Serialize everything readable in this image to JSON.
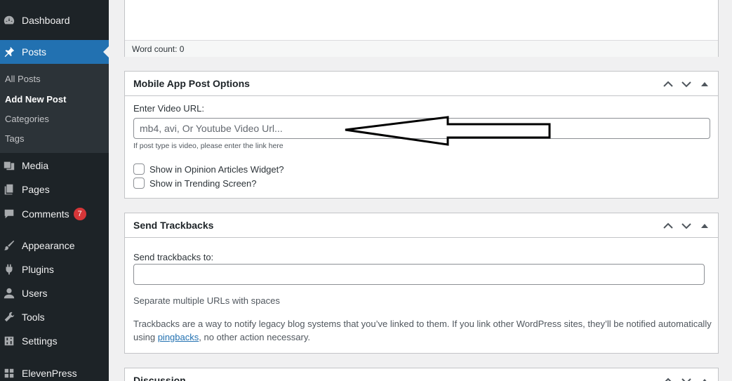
{
  "sidebar": {
    "items": [
      {
        "label": "Dashboard",
        "icon": "dashboard-icon"
      },
      {
        "label": "Posts",
        "icon": "pin-icon",
        "active": true
      },
      {
        "label": "Media",
        "icon": "media-icon"
      },
      {
        "label": "Pages",
        "icon": "pages-icon"
      },
      {
        "label": "Comments",
        "icon": "comment-icon",
        "badge": "7"
      },
      {
        "label": "Appearance",
        "icon": "brush-icon"
      },
      {
        "label": "Plugins",
        "icon": "plugin-icon"
      },
      {
        "label": "Users",
        "icon": "user-icon"
      },
      {
        "label": "Tools",
        "icon": "wrench-icon"
      },
      {
        "label": "Settings",
        "icon": "settings-icon"
      },
      {
        "label": "ElevenPress",
        "icon": "grid-icon"
      }
    ],
    "submenu": [
      "All Posts",
      "Add New Post",
      "Categories",
      "Tags"
    ],
    "colors": {
      "bg": "#1d2327",
      "active": "#2271b1",
      "badge": "#d63638"
    }
  },
  "editor": {
    "word_count": "Word count: 0"
  },
  "mobile_options": {
    "title": "Mobile App Post Options",
    "video_label": "Enter Video URL:",
    "video_placeholder": "mb4, avi, Or Youtube Video Url...",
    "video_help": "If post type is video, please enter the link here",
    "opinion_checkbox": "Show in Opinion Articles Widget?",
    "trending_checkbox": "Show in Trending Screen?"
  },
  "trackbacks": {
    "title": "Send Trackbacks",
    "label": "Send trackbacks to:",
    "hint": "Separate multiple URLs with spaces",
    "desc_part1": "Trackbacks are a way to notify legacy blog systems that you’ve linked to them. If you link other WordPress sites, they’ll be notified automatically",
    "desc_part2": "using ",
    "desc_link": "pingbacks",
    "desc_part3": ", no other action necessary."
  },
  "discussion": {
    "title": "Discussion"
  }
}
